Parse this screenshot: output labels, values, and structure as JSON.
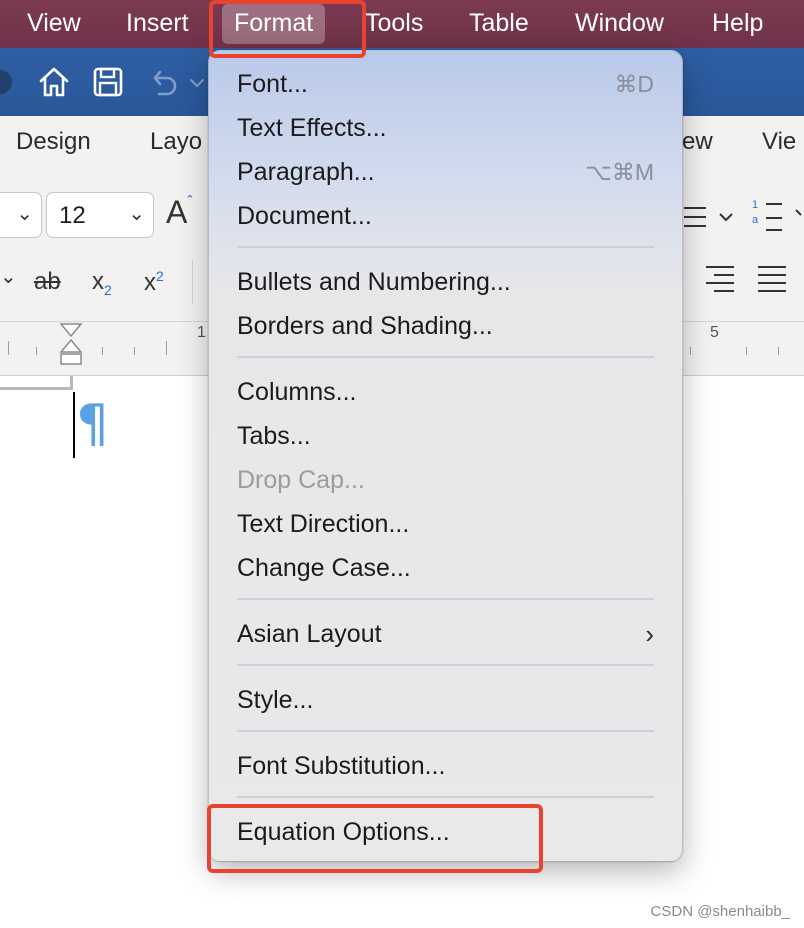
{
  "menubar": {
    "items": [
      "View",
      "Insert",
      "Format",
      "Tools",
      "Table",
      "Window",
      "Help"
    ],
    "active": "Format",
    "colors": {
      "background": "#73354c",
      "text": "#ffffff"
    }
  },
  "quick_access": {
    "icons": [
      "home-icon",
      "save-icon",
      "undo-icon"
    ],
    "colors": {
      "background": "#2b5797"
    }
  },
  "ribbon": {
    "tabs": [
      "Design",
      "Layo",
      "ew",
      "Vie"
    ],
    "font_size_value": "12",
    "grow_font_label": "A",
    "strikethrough_label": "ab",
    "subscript_label": "x",
    "superscript_label": "x"
  },
  "ruler": {
    "numbers": [
      "1",
      "5"
    ]
  },
  "document": {
    "paragraph_mark": "¶"
  },
  "format_menu": {
    "items": [
      {
        "label": "Font...",
        "shortcut": "⌘D"
      },
      {
        "label": "Text Effects..."
      },
      {
        "label": "Paragraph...",
        "shortcut": "⌥⌘M"
      },
      {
        "label": "Document..."
      },
      {
        "label": "Bullets and Numbering..."
      },
      {
        "label": "Borders and Shading..."
      },
      {
        "label": "Columns..."
      },
      {
        "label": "Tabs..."
      },
      {
        "label": "Drop Cap...",
        "disabled": true
      },
      {
        "label": "Text Direction..."
      },
      {
        "label": "Change Case..."
      },
      {
        "label": "Asian Layout",
        "submenu": true
      },
      {
        "label": "Style..."
      },
      {
        "label": "Font Substitution..."
      },
      {
        "label": "Equation Options...",
        "highlighted": true
      }
    ],
    "submenu_glyph": "›"
  },
  "highlight_color": "#e8432e",
  "watermark": "CSDN @shenhaibb_"
}
